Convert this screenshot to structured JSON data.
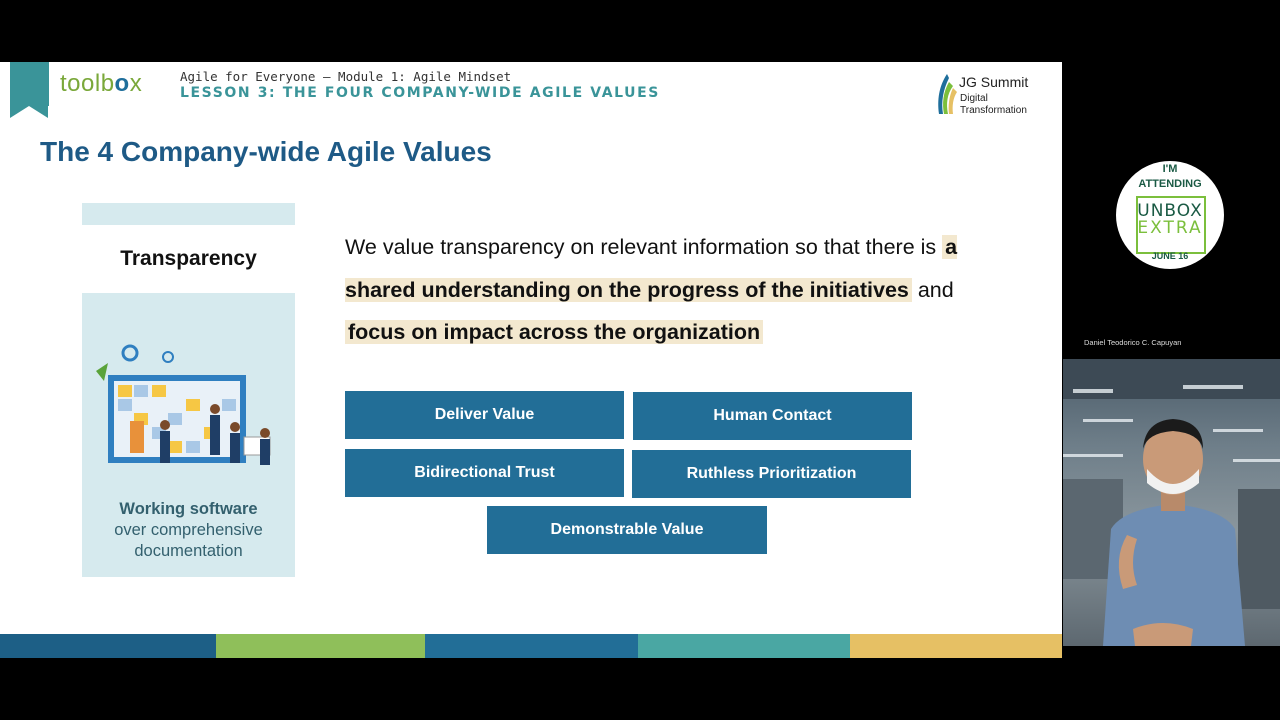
{
  "slide": {
    "logo": {
      "part1": "toolb",
      "part2": "o",
      "part3": "x"
    },
    "course_title": "Agile for Everyone – Module 1: Agile Mindset",
    "lesson_title": "LESSON 3: THE FOUR COMPANY-WIDE AGILE VALUES",
    "brand": {
      "name": "JG Summit",
      "sub1": "Digital",
      "sub2": "Transformation"
    },
    "title": "The 4 Company-wide Agile Values",
    "card": {
      "heading": "Transparency",
      "caption_bold": "Working software",
      "caption_line1": "over comprehensive",
      "caption_line2": "documentation"
    },
    "statement": {
      "part1": "We value transparency on relevant information so that there is ",
      "highlight1": "a shared understanding on the progress of the initiatives",
      "part2": " and ",
      "highlight2": "focus on impact across the organization"
    },
    "values": {
      "deliver": "Deliver Value",
      "human": "Human Contact",
      "bidirectional": "Bidirectional Trust",
      "ruthless": "Ruthless Prioritization",
      "demonstrable": "Demonstrable Value"
    },
    "color_bar": [
      "#1d5f86",
      "#8fbf5a",
      "#226e97",
      "#4aa7a3",
      "#e6c064"
    ]
  },
  "badge": {
    "line1": "I'M",
    "line2": "ATTENDING",
    "line3": "UNBOX",
    "line4": "EXTRA",
    "date": "JUNE 16"
  },
  "participant": {
    "name": "Daniel Teodorico C. Capuyan"
  }
}
